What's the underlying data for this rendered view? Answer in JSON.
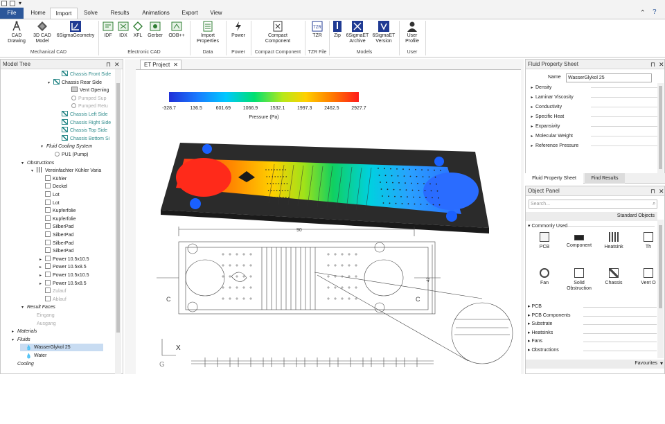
{
  "ribbon": {
    "tabs": [
      "File",
      "Home",
      "Import",
      "Solve",
      "Results",
      "Animations",
      "Export",
      "View"
    ],
    "active_tab": "Import",
    "groups": [
      {
        "label": "Mechanical CAD",
        "buttons": [
          [
            "CAD",
            "Drawing"
          ],
          [
            "3D CAD",
            "Model"
          ],
          [
            "6SigmaGeometry"
          ]
        ]
      },
      {
        "label": "Electronic CAD",
        "buttons": [
          [
            "IDF"
          ],
          [
            "IDX"
          ],
          [
            "XFL"
          ],
          [
            "Gerber"
          ],
          [
            "ODB++"
          ]
        ]
      },
      {
        "label": "Data",
        "buttons": [
          [
            "Import",
            "Properties"
          ]
        ]
      },
      {
        "label": "Power",
        "buttons": [
          [
            "Power"
          ]
        ]
      },
      {
        "label": "Compact Component",
        "buttons": [
          [
            "Compact",
            "Component"
          ]
        ]
      },
      {
        "label": "TZR File",
        "buttons": [
          [
            "TZR"
          ]
        ]
      },
      {
        "label": "Models",
        "buttons": [
          [
            "Zip"
          ],
          [
            "6SigmaET",
            "Archive"
          ],
          [
            "6SigmaET",
            "Version"
          ]
        ]
      },
      {
        "label": "User",
        "buttons": [
          [
            "User",
            "Profile"
          ]
        ]
      }
    ]
  },
  "model_tree": {
    "title": "Model Tree",
    "items": [
      {
        "label": "Chassis Front Side",
        "style": "cyan",
        "icon": "chassis-icon"
      },
      {
        "label": "Chassis Rear Side",
        "style": "normal",
        "icon": "chassis-icon"
      },
      {
        "label": "Vent Opening",
        "style": "normal",
        "icon": "vent-icon"
      },
      {
        "label": "Pumped Sup",
        "style": "grey",
        "icon": "pump-icon"
      },
      {
        "label": "Pumped Retu",
        "style": "grey",
        "icon": "pump-icon"
      },
      {
        "label": "Chassis Left Side",
        "style": "cyan",
        "icon": "chassis-icon"
      },
      {
        "label": "Chassis Right Side",
        "style": "cyan",
        "icon": "chassis-icon"
      },
      {
        "label": "Chassis Top Side",
        "style": "cyan",
        "icon": "chassis-icon"
      },
      {
        "label": "Chassis Bottom Si",
        "style": "cyan",
        "icon": "chassis-icon"
      },
      {
        "label": "Fluid Cooling System",
        "style": "italic"
      },
      {
        "label": "PU1 (Pump)",
        "style": "normal",
        "icon": "pump-icon"
      },
      {
        "label": "Obstructions",
        "style": "italic"
      },
      {
        "label": "Vereinfachter Kühler Varia",
        "style": "normal",
        "icon": "assembly-icon"
      },
      {
        "label": "Kühler",
        "style": "normal"
      },
      {
        "label": "Deckel",
        "style": "normal"
      },
      {
        "label": "Lot",
        "style": "normal"
      },
      {
        "label": "Lot",
        "style": "normal"
      },
      {
        "label": "Kupferfolie",
        "style": "normal"
      },
      {
        "label": "Kupferfolie",
        "style": "normal"
      },
      {
        "label": "SilberPad",
        "style": "normal"
      },
      {
        "label": "SilberPad",
        "style": "normal"
      },
      {
        "label": "SilberPad",
        "style": "normal"
      },
      {
        "label": "SilberPad",
        "style": "normal"
      },
      {
        "label": "Power 10.5x10.5",
        "style": "normal"
      },
      {
        "label": "Power 10.5x8.5",
        "style": "normal"
      },
      {
        "label": "Power 10.5x10.5",
        "style": "normal"
      },
      {
        "label": "Power 10.5x8.5",
        "style": "normal"
      },
      {
        "label": "Zulauf",
        "style": "grey"
      },
      {
        "label": "Ablauf",
        "style": "grey"
      },
      {
        "label": "Result Faces",
        "style": "italic"
      },
      {
        "label": "Eingang",
        "style": "grey"
      },
      {
        "label": "Ausgang",
        "style": "grey"
      },
      {
        "label": "Materials",
        "style": "italic"
      },
      {
        "label": "Fluids",
        "style": "italic"
      },
      {
        "label": "WasserGlykol 25",
        "style": "selected",
        "icon": "drop-icon"
      },
      {
        "label": "Water",
        "style": "normal",
        "icon": "drop-icon"
      },
      {
        "label": "Cooling",
        "style": "italic"
      }
    ]
  },
  "document": {
    "tab_label": "ET Project",
    "colorbar": {
      "ticks": [
        "-328.7",
        "136.5",
        "601.69",
        "1066.9",
        "1532.1",
        "1997.3",
        "2462.5",
        "2927.7"
      ],
      "label": "Pressure (Pa)"
    },
    "drawing": {
      "dim_top": "90",
      "section_left": "C",
      "section_right": "C",
      "dim_right": "42",
      "axis_x": "X",
      "axis_g": "G"
    }
  },
  "fluid_sheet": {
    "title": "Fluid Property Sheet",
    "name_label": "Name",
    "name_value": "WasserGlykol 25",
    "properties": [
      "Density",
      "Laminar Viscosity",
      "Conductivity",
      "Specific Heat",
      "Expansivity",
      "Molecular Weight",
      "Reference Pressure"
    ],
    "tabs": [
      "Fluid Property Sheet",
      "Find Results"
    ]
  },
  "object_panel": {
    "title": "Object Panel",
    "search_placeholder": "Search...",
    "standard_label": "Standard Objects",
    "common_label": "Commonly Used",
    "objects": [
      {
        "label": "PCB",
        "icon": "pcb-icon"
      },
      {
        "label": "Component",
        "icon": "component-icon"
      },
      {
        "label": "Heatsink",
        "icon": "heatsink-icon"
      },
      {
        "label": "Th",
        "icon": "generic-icon"
      },
      {
        "label": "Fan",
        "icon": "fan-icon"
      },
      {
        "label": "Solid Obstruction",
        "icon": "solid-obstruction-icon"
      },
      {
        "label": "Chassis",
        "icon": "chassis-icon"
      },
      {
        "label": "Vent O",
        "icon": "vent-icon"
      }
    ],
    "sections": [
      "PCB",
      "PCB Components",
      "Substrate",
      "Heatsinks",
      "Fans",
      "Obstructions"
    ],
    "favourites_label": "Favourites"
  }
}
